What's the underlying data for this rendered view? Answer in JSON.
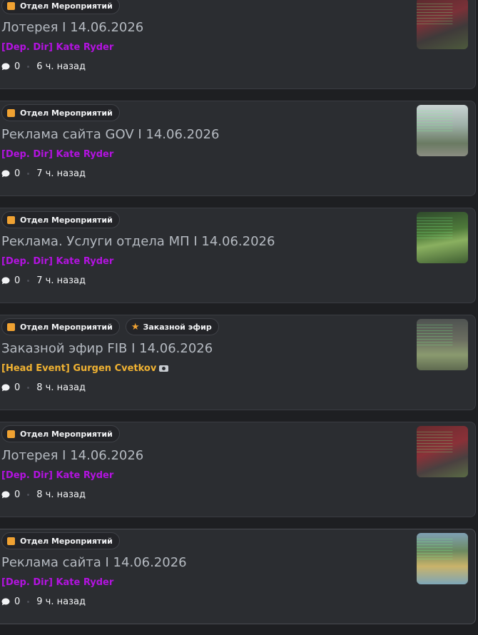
{
  "tag_events": "Отдел Мероприятий",
  "tag_ordered_broadcast": "Заказной эфир",
  "posts": [
    {
      "title": "Лотерея I 14.06.2026",
      "author": "[Dep. Dir] Kate Ryder",
      "comments": "0",
      "time": "6 ч. назад",
      "thumb_icon": "screenshot-thumbnail"
    },
    {
      "title": "Реклама сайта GOV I 14.06.2026",
      "author": "[Dep. Dir] Kate Ryder",
      "comments": "0",
      "time": "7 ч. назад",
      "thumb_icon": "screenshot-thumbnail"
    },
    {
      "title": "Реклама. Услуги отдела МП I 14.06.2026",
      "author": "[Dep. Dir] Kate Ryder",
      "comments": "0",
      "time": "7 ч. назад",
      "thumb_icon": "screenshot-thumbnail"
    },
    {
      "title": "Заказной эфир FIB I 14.06.2026",
      "author": "[Head Event] Gurgen Cvetkov",
      "comments": "0",
      "time": "8 ч. назад",
      "thumb_icon": "screenshot-thumbnail"
    },
    {
      "title": "Лотерея I 14.06.2026",
      "author": "[Dep. Dir] Kate Ryder",
      "comments": "0",
      "time": "8 ч. назад",
      "thumb_icon": "screenshot-thumbnail"
    },
    {
      "title": "Реклама сайта I 14.06.2026",
      "author": "[Dep. Dir] Kate Ryder",
      "comments": "0",
      "time": "9 ч. назад",
      "thumb_icon": "screenshot-thumbnail"
    }
  ],
  "colors": {
    "background": "#1e1f22",
    "card": "#2b2d31",
    "title": "#b5bac1",
    "author_dep_dir": "#b313e0",
    "author_head_event": "#f0b232",
    "tag_icon": "#f0a232"
  }
}
